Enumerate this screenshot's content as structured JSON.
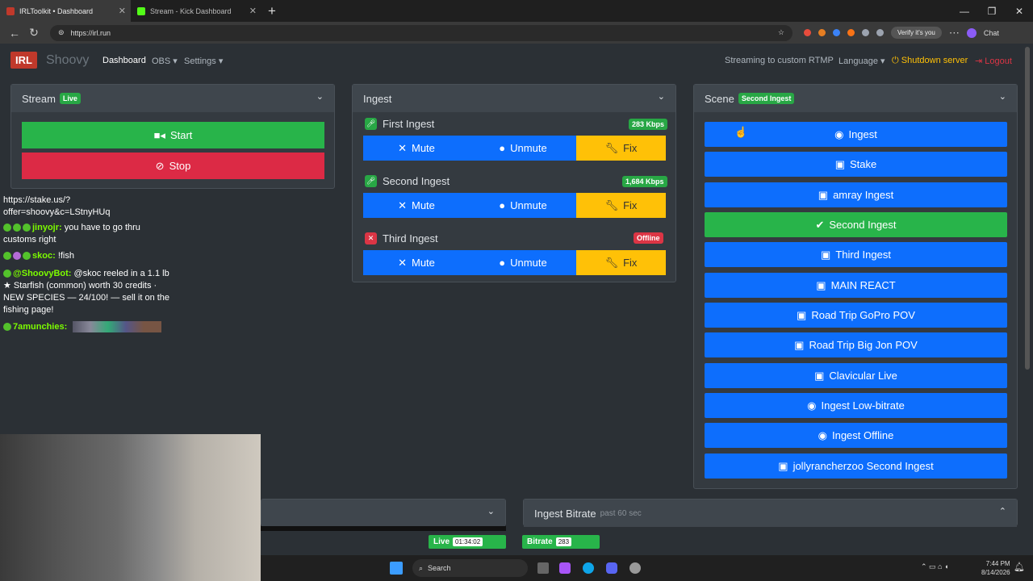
{
  "browser": {
    "tabs": [
      {
        "title": "IRLToolkit • Dashboard",
        "active": true
      },
      {
        "title": "Stream - Kick Dashboard",
        "active": false
      }
    ],
    "url": "https://irl.run",
    "verify": "Verify it's you",
    "chat": "Chat"
  },
  "nav": {
    "logo": "IRL",
    "brand": "Shoovy",
    "dashboard": "Dashboard",
    "obs": "OBS",
    "settings": "Settings",
    "streaming": "Streaming to custom RTMP",
    "language": "Language",
    "shutdown": "Shutdown server",
    "logout": "Logout"
  },
  "stream": {
    "title": "Stream",
    "badge": "Live",
    "start": "Start",
    "stop": "Stop"
  },
  "ingest": {
    "title": "Ingest",
    "mute": "Mute",
    "unmute": "Unmute",
    "fix": "Fix",
    "items": [
      {
        "name": "First Ingest",
        "status": "283 Kbps",
        "online": true
      },
      {
        "name": "Second Ingest",
        "status": "1,684 Kbps",
        "online": true
      },
      {
        "name": "Third Ingest",
        "status": "Offline",
        "online": false
      }
    ]
  },
  "scene": {
    "title": "Scene",
    "badge": "Second Ingest",
    "items": [
      {
        "label": "Ingest",
        "icon": "robot-icon"
      },
      {
        "label": "Stake",
        "icon": "image-icon"
      },
      {
        "label": "amray Ingest",
        "icon": "image-icon"
      },
      {
        "label": "Second Ingest",
        "icon": "check-icon",
        "selected": true
      },
      {
        "label": "Third Ingest",
        "icon": "image-icon"
      },
      {
        "label": "MAIN REACT",
        "icon": "image-icon"
      },
      {
        "label": "Road Trip GoPro POV",
        "icon": "image-icon"
      },
      {
        "label": "Road Trip Big Jon POV",
        "icon": "image-icon"
      },
      {
        "label": "Clavicular Live",
        "icon": "image-icon"
      },
      {
        "label": "Ingest Low-bitrate",
        "icon": "robot-icon"
      },
      {
        "label": "Ingest Offline",
        "icon": "robot-icon"
      },
      {
        "label": "jollyrancherzoo Second Ingest",
        "icon": "image-icon"
      }
    ]
  },
  "bitrate_card": {
    "title": "Ingest Bitrate",
    "sub": "past 60 sec"
  },
  "status": {
    "live_label": "Live",
    "live_time": "01:34:02",
    "bitrate_label": "Bitrate",
    "bitrate_value": "283"
  },
  "chat": {
    "line0a": "https://stake.us/?",
    "line0b": "offer=shoovy&c=LStnyHUq",
    "m1_user": "jinyojr:",
    "m1_text": "you have to go thru",
    "m1_text2": "customs right",
    "m2_user": "skoc:",
    "m2_text": "!fish",
    "m3_user": "@ShoovyBot:",
    "m3_text": "@skoc reeled in a 1.1 lb",
    "m3_text2": "★ Starfish (common) worth 30 credits ·",
    "m3_text3": "NEW SPECIES — 24/100! — sell it on the",
    "m3_text4": "fishing page!",
    "m4_user": "7amunchies:"
  },
  "taskbar": {
    "search": "Search",
    "time": "7:44 PM",
    "date": "8/14/2026"
  }
}
